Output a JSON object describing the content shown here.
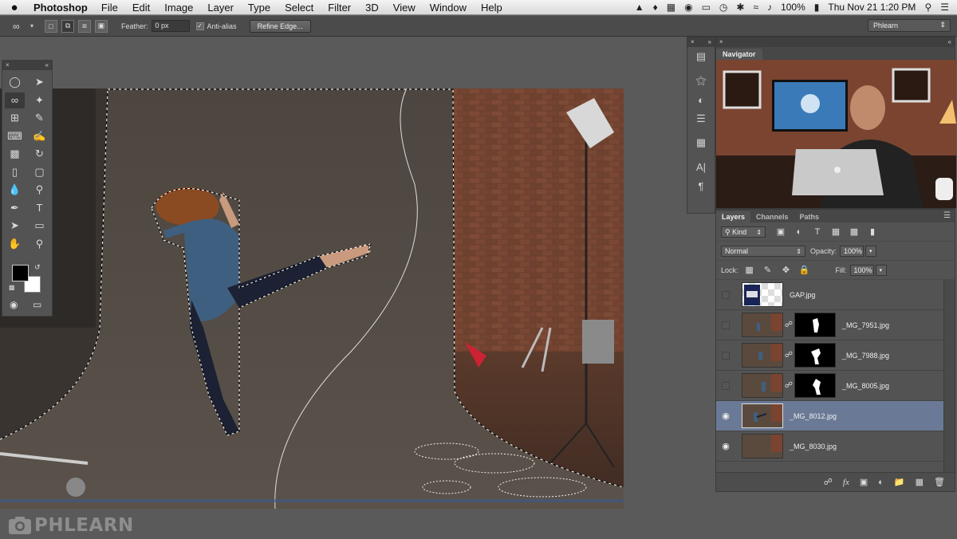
{
  "menubar": {
    "app_name": "Photoshop",
    "items": [
      "File",
      "Edit",
      "Image",
      "Layer",
      "Type",
      "Select",
      "Filter",
      "3D",
      "View",
      "Window",
      "Help"
    ],
    "battery": "100%",
    "datetime": "Thu Nov 21  1:20 PM"
  },
  "options": {
    "feather_label": "Feather:",
    "feather_value": "0 px",
    "antialias_label": "Anti-alias",
    "refine_edge_label": "Refine Edge...",
    "workspace": "Phlearn"
  },
  "navigator": {
    "tab": "Navigator"
  },
  "layers_panel": {
    "tabs": [
      "Layers",
      "Channels",
      "Paths"
    ],
    "filter_kind": "Kind",
    "blend_mode": "Normal",
    "opacity_label": "Opacity:",
    "opacity_value": "100%",
    "lock_label": "Lock:",
    "fill_label": "Fill:",
    "fill_value": "100%",
    "layers": [
      {
        "name": "GAP.jpg",
        "visible": false,
        "has_mask": false,
        "selected": false,
        "thumb": "gap"
      },
      {
        "name": "_MG_7951.jpg",
        "visible": false,
        "has_mask": true,
        "selected": false,
        "thumb": "photo"
      },
      {
        "name": "_MG_7988.jpg",
        "visible": false,
        "has_mask": true,
        "selected": false,
        "thumb": "photo"
      },
      {
        "name": "_MG_8005.jpg",
        "visible": false,
        "has_mask": true,
        "selected": false,
        "thumb": "photo"
      },
      {
        "name": "_MG_8012.jpg",
        "visible": true,
        "has_mask": false,
        "selected": true,
        "thumb": "photo"
      },
      {
        "name": "_MG_8030.jpg",
        "visible": true,
        "has_mask": false,
        "selected": false,
        "thumb": "photo"
      }
    ]
  },
  "watermark": {
    "text": "PHLEARN"
  },
  "colors": {
    "selection_highlight": "#6a7a96",
    "panel_bg": "#535353",
    "canvas_backdrop": "#55504b"
  }
}
